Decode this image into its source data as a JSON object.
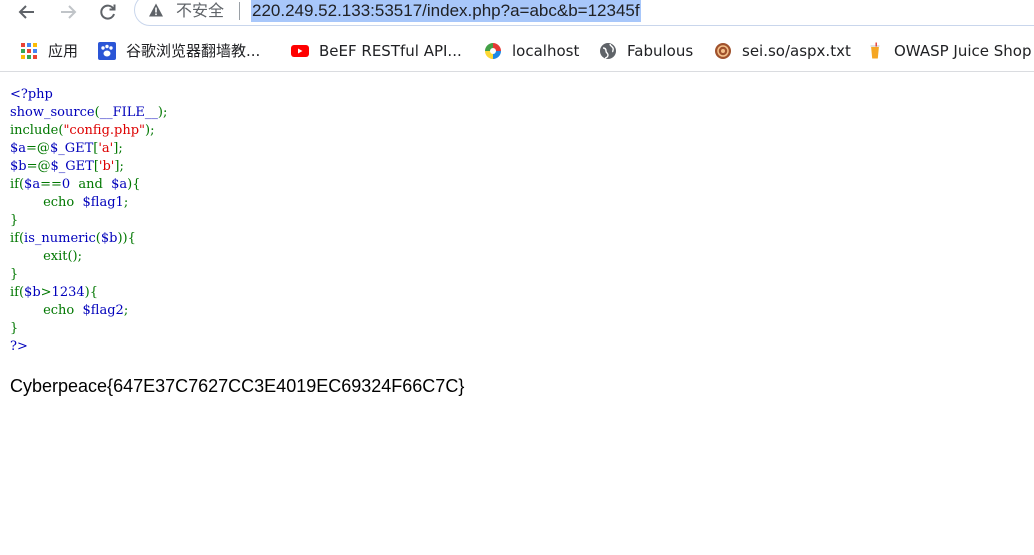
{
  "browser": {
    "security_label": "不安全",
    "url": "220.249.52.133:53517/index.php?a=abc&b=12345f",
    "bookmarks": [
      {
        "icon": "apps-grid-icon",
        "label": "应用"
      },
      {
        "icon": "paw-icon",
        "label": "谷歌浏览器翻墙教..."
      },
      {
        "icon": "youtube-icon",
        "label": "BeEF RESTful API..."
      },
      {
        "icon": "localhost-icon",
        "label": "localhost"
      },
      {
        "icon": "globe-icon",
        "label": "Fabulous"
      },
      {
        "icon": "site-icon",
        "label": "sei.so/aspx.txt"
      },
      {
        "icon": "juice-shop-icon",
        "label": "OWASP Juice Shop"
      }
    ]
  },
  "source": {
    "l1": "<?php",
    "l2_fn": "show_source",
    "l2_arg": "__FILE__",
    "l3_kw": "include",
    "l3_str": "\"config.php\"",
    "l4_var": "$a",
    "l4_get": "$_GET",
    "l4_key": "'a'",
    "l5_var": "$b",
    "l5_get": "$_GET",
    "l5_key": "'b'",
    "l6_cond": "$a",
    "l6_zero": "0",
    "l6_and": "and",
    "l6_var": "$a",
    "l7_echo": "echo",
    "l7_var": "$flag1",
    "l9_fn": "is_numeric",
    "l9_arg": "$b",
    "l10_exit": "exit",
    "l12_var": "$b",
    "l12_num": "1234",
    "l13_echo": "echo",
    "l13_var": "$flag2",
    "l15": "?>"
  },
  "output": {
    "flag": "Cyberpeace{647E37C7627CC3E4019EC69324F66C7C}"
  },
  "colors": {
    "php_keyword": "#007700",
    "php_default": "#0000bb",
    "php_string": "#dd0000",
    "url_highlight": "#a8c7fa"
  }
}
